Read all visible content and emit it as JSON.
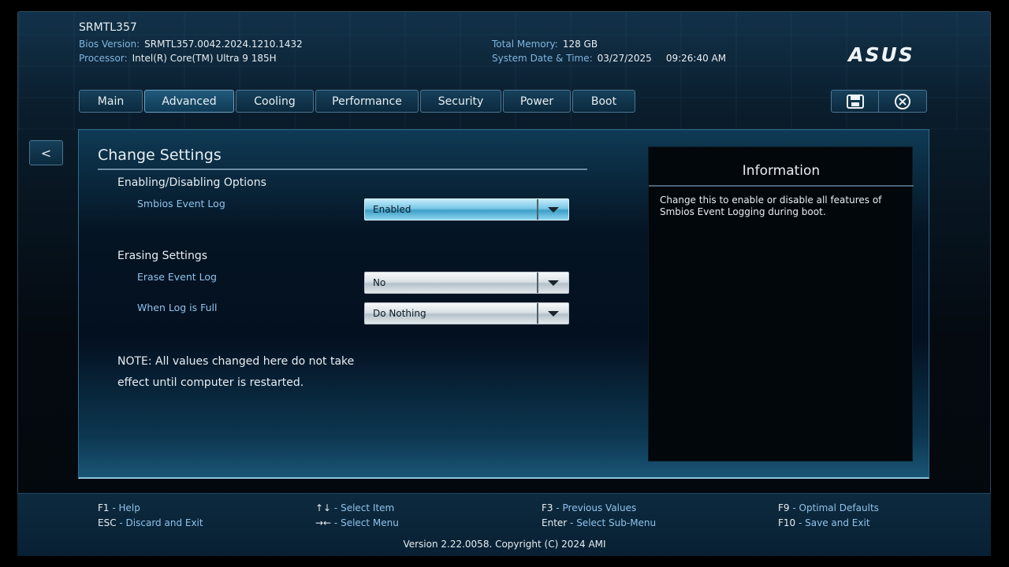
{
  "header": {
    "model": "SRMTL357",
    "bios_label": "Bios Version:",
    "bios_value": "SRMTL357.0042.2024.1210.1432",
    "processor_label": "Processor:",
    "processor_value": "Intel(R) Core(TM) Ultra 9 185H",
    "memory_label": "Total Memory:",
    "memory_value": "128 GB",
    "datetime_label": "System Date & Time:",
    "date_value": "03/27/2025",
    "time_value": "09:26:40 AM",
    "brand": "ASUS"
  },
  "tabs": [
    {
      "label": "Main"
    },
    {
      "label": "Advanced"
    },
    {
      "label": "Cooling"
    },
    {
      "label": "Performance"
    },
    {
      "label": "Security"
    },
    {
      "label": "Power"
    },
    {
      "label": "Boot"
    }
  ],
  "back_label": "<",
  "panel": {
    "title": "Change Settings",
    "section1": "Enabling/Disabling Options",
    "smbios_label": "Smbios Event Log",
    "smbios_value": "Enabled",
    "section2": "Erasing Settings",
    "erase_label": "Erase Event Log",
    "erase_value": "No",
    "full_label": "When Log is Full",
    "full_value": "Do Nothing",
    "note": "NOTE: All values changed here do not take effect until computer is restarted."
  },
  "info": {
    "title": "Information",
    "text": "Change this to enable or disable all features of Smbios Event Logging during boot."
  },
  "footer": {
    "keys": [
      {
        "key": "F1",
        "action": "Help"
      },
      {
        "key": "ESC",
        "action": "Discard and Exit"
      },
      {
        "key": "↑↓",
        "action": "Select Item"
      },
      {
        "key": "→←",
        "action": "Select Menu"
      },
      {
        "key": "F3",
        "action": "Previous Values"
      },
      {
        "key": "Enter",
        "action": "Select Sub-Menu"
      },
      {
        "key": "F9",
        "action": "Optimal Defaults"
      },
      {
        "key": "F10",
        "action": "Save and Exit"
      }
    ],
    "separator": " - ",
    "copyright": "Version 2.22.0058. Copyright (C) 2024 AMI"
  },
  "colors": {
    "accent_label": "#8fc3ec",
    "focused_select": "#3d9fc7",
    "panel_border": "#2f6d8f"
  }
}
